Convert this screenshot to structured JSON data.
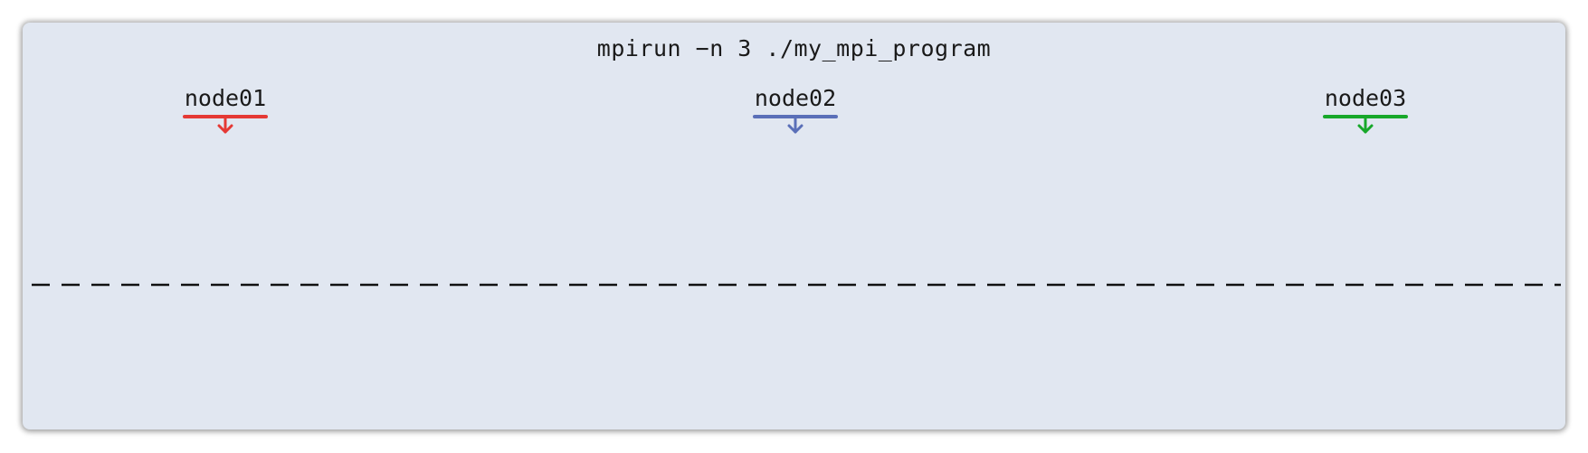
{
  "command": "mpirun −n 3 ./my_mpi_program",
  "nodes": [
    {
      "label": "node01",
      "color": "#e53935"
    },
    {
      "label": "node02",
      "color": "#5a6fb8"
    },
    {
      "label": "node03",
      "color": "#17a82a"
    }
  ]
}
